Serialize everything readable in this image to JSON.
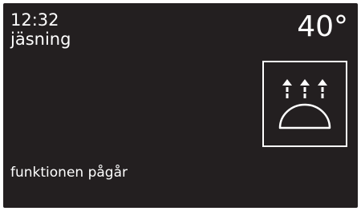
{
  "display": {
    "time": "12:32",
    "mode": "jäsning",
    "temperature": "40°",
    "icon": "proofing-icon",
    "status": "funktionen pågår"
  },
  "colors": {
    "background": "#231f20",
    "foreground": "#ffffff"
  }
}
